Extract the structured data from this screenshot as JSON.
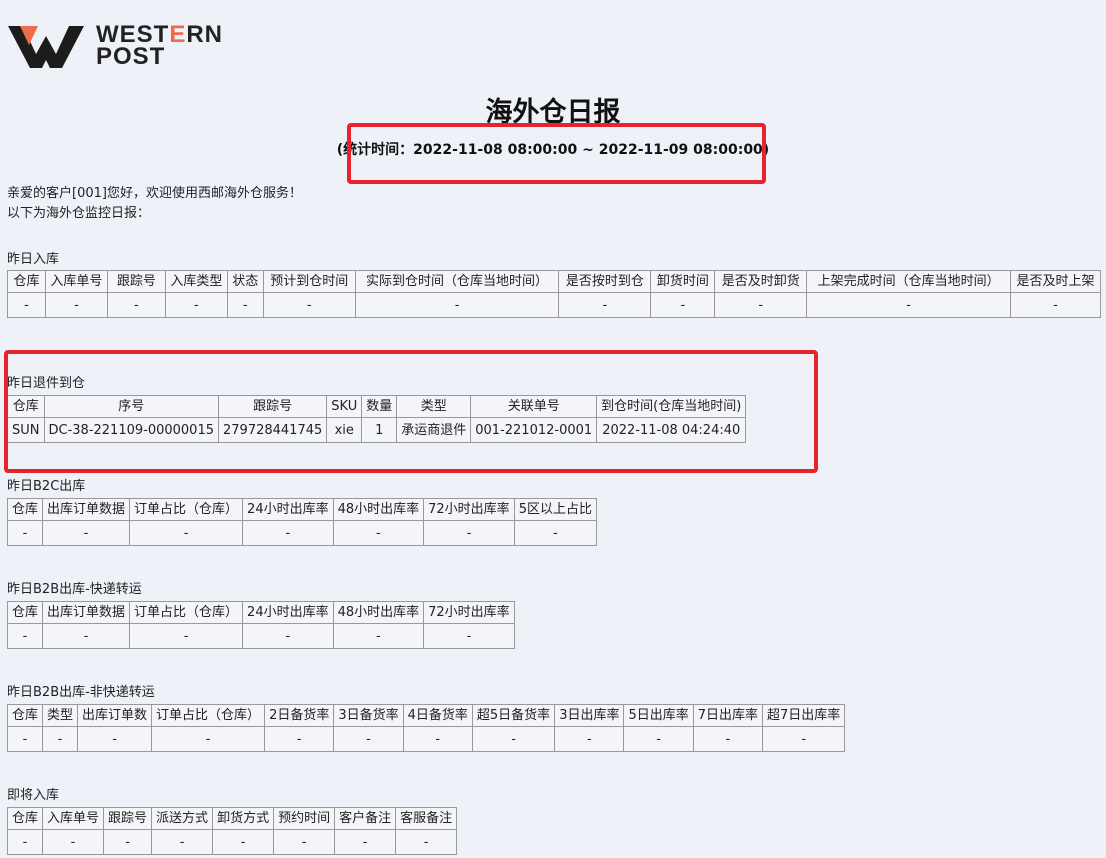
{
  "brand": {
    "line1_part1": "WEST",
    "line1_accent": "E",
    "line1_part2": "RN",
    "line2": "POST",
    "accent_color": "#ef6b4a"
  },
  "report": {
    "title": "海外仓日报",
    "period": "(统计时间：2022-11-08 08:00:00 ~ 2022-11-09 08:00:00)"
  },
  "greeting": {
    "line1": "亲爱的客户[001]您好，欢迎使用西邮海外仓服务！",
    "line2": "以下为海外仓监控日报："
  },
  "highlight_color": "#e8232b",
  "sections": {
    "inbound": {
      "title": "昨日入库",
      "headers": [
        "仓库",
        "入库单号",
        "跟踪号",
        "入库类型",
        "状态",
        "预计到仓时间",
        "实际到仓时间（仓库当地时间）",
        "是否按时到仓",
        "卸货时间",
        "是否及时卸货",
        "上架完成时间（仓库当地时间）",
        "是否及时上架"
      ],
      "rows": [
        [
          "-",
          "-",
          "-",
          "-",
          "-",
          "-",
          "-",
          "-",
          "-",
          "-",
          "-",
          "-"
        ]
      ]
    },
    "returns": {
      "title": "昨日退件到仓",
      "headers": [
        "仓库",
        "序号",
        "跟踪号",
        "SKU",
        "数量",
        "类型",
        "关联单号",
        "到仓时间(仓库当地时间)"
      ],
      "rows": [
        [
          "SUN",
          "DC-38-221109-00000015",
          "279728441745",
          "xie",
          "1",
          "承运商退件",
          "001-221012-0001",
          "2022-11-08 04:24:40"
        ]
      ]
    },
    "b2c": {
      "title": "昨日B2C出库",
      "headers": [
        "仓库",
        "出库订单数据",
        "订单占比（仓库）",
        "24小时出库率",
        "48小时出库率",
        "72小时出库率",
        "5区以上占比"
      ],
      "rows": [
        [
          "-",
          "-",
          "-",
          "-",
          "-",
          "-",
          "-"
        ]
      ]
    },
    "b2b_express": {
      "title": "昨日B2B出库-快递转运",
      "headers": [
        "仓库",
        "出库订单数据",
        "订单占比（仓库）",
        "24小时出库率",
        "48小时出库率",
        "72小时出库率"
      ],
      "rows": [
        [
          "-",
          "-",
          "-",
          "-",
          "-",
          "-"
        ]
      ]
    },
    "b2b_nonexpress": {
      "title": "昨日B2B出库-非快递转运",
      "headers": [
        "仓库",
        "类型",
        "出库订单数",
        "订单占比（仓库）",
        "2日备货率",
        "3日备货率",
        "4日备货率",
        "超5日备货率",
        "3日出库率",
        "5日出库率",
        "7日出库率",
        "超7日出库率"
      ],
      "rows": [
        [
          "-",
          "-",
          "-",
          "-",
          "-",
          "-",
          "-",
          "-",
          "-",
          "-",
          "-",
          "-"
        ]
      ]
    },
    "upcoming": {
      "title": "即将入库",
      "headers": [
        "仓库",
        "入库单号",
        "跟踪号",
        "派送方式",
        "卸货方式",
        "预约时间",
        "客户备注",
        "客服备注"
      ],
      "rows": [
        [
          "-",
          "-",
          "-",
          "-",
          "-",
          "-",
          "-",
          "-"
        ]
      ]
    }
  }
}
